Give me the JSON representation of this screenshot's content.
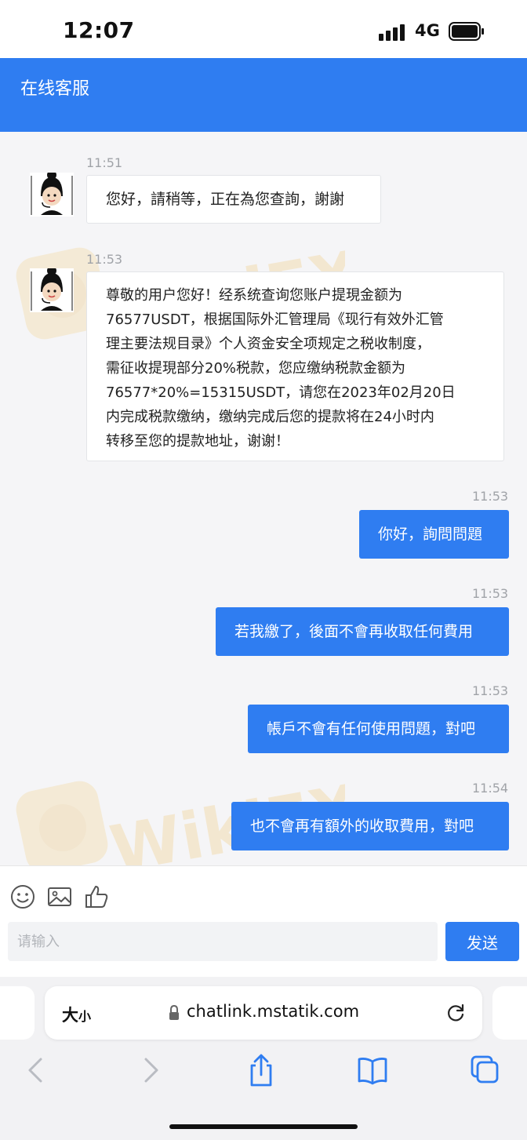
{
  "status_bar": {
    "time": "12:07",
    "network": "4G"
  },
  "header": {
    "title": "在线客服"
  },
  "messages": [
    {
      "time": "11:51",
      "direction": "in",
      "lines": [
        "您好，請稍等，正在為您查詢，謝謝"
      ]
    },
    {
      "time": "11:53",
      "direction": "in",
      "lines": [
        "尊敬的用户您好！经系统查询您账户提現金额为",
        "76577USDT，根据国际外汇管理局《现行有效外汇管",
        "理主要法规目录》个人资金安全项规定之税收制度，",
        "需征收提現部分20%税款，您应缴纳税款金额为",
        "76577*20%=15315USDT，请您在2023年02月20日",
        "内完成税款缴纳，缴纳完成后您的提款将在24小时内",
        "转移至您的提款地址，谢谢！"
      ]
    },
    {
      "time": "11:53",
      "direction": "out",
      "lines": [
        "你好，詢問問題"
      ]
    },
    {
      "time": "11:53",
      "direction": "out",
      "lines": [
        "若我繳了，後面不會再收取任何費用"
      ]
    },
    {
      "time": "11:53",
      "direction": "out",
      "lines": [
        "帳戶不會有任何使用問題，對吧"
      ]
    },
    {
      "time": "11:54",
      "direction": "out",
      "lines": [
        "也不會再有額外的收取費用，對吧"
      ]
    }
  ],
  "watermark": {
    "text": "WikiFX"
  },
  "composer": {
    "icons": [
      "emoji-icon",
      "image-icon",
      "thumbs-up-icon"
    ],
    "placeholder": "请输入",
    "send_label": "发送"
  },
  "browser": {
    "text_size_label": "大",
    "text_size_small": "小",
    "url": "chatlink.mstatik.com",
    "toolbar_icons": [
      "back-icon",
      "forward-icon",
      "share-icon",
      "bookmarks-icon",
      "tabs-icon"
    ]
  },
  "colors": {
    "accent": "#2f7df1",
    "background": "#f5f5f7",
    "bubble_in": "#ffffff",
    "timestamp": "#a0a3a8"
  }
}
